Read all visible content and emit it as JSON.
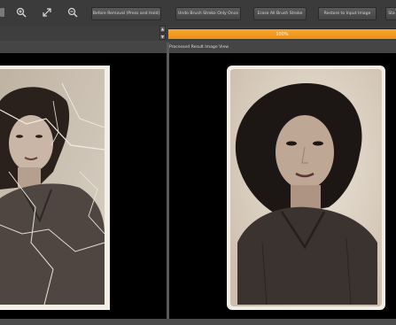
{
  "toolbar": {
    "icons": [
      "zoom-in-icon",
      "fit-screen-icon",
      "zoom-out-icon"
    ],
    "buttons": [
      {
        "label": "Before Removal (Press and Hold)"
      },
      {
        "label": "Undo Brush Stroke Only Once"
      },
      {
        "label": "Erase All Brush Stroke"
      },
      {
        "label": "Restore to Input Image"
      },
      {
        "label": "Sta"
      }
    ]
  },
  "progress": {
    "text": "100%",
    "value": 100
  },
  "spinner": {
    "up": "▲",
    "down": "▼"
  },
  "views": {
    "right_label": "Processed Result Image View"
  },
  "colors": {
    "accent": "#f2992a",
    "background": "#454545",
    "view_bg": "#000000"
  }
}
